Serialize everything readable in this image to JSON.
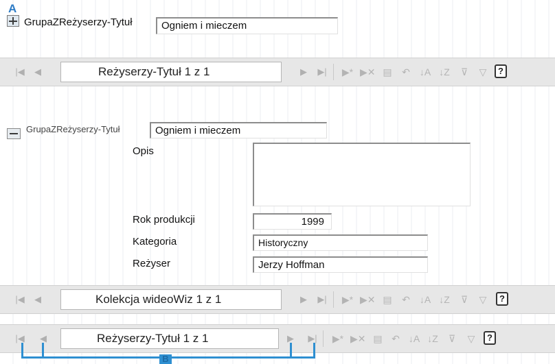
{
  "markers": {
    "a": "A",
    "b": "B"
  },
  "sectionA": {
    "group_label": "GrupaZReżyserzy-Tytuł",
    "title_value": "Ogniem i mieczem"
  },
  "nav1": {
    "record_text": "Reżyserzy-Tytuł 1 z 1",
    "help_label": "?"
  },
  "sectionB": {
    "group_label": "GrupaZReżyserzy-Tytuł",
    "title_value": "Ogniem i mieczem",
    "fields": [
      {
        "label": "Opis",
        "value": ""
      },
      {
        "label": "Rok produkcji",
        "value": "1999"
      },
      {
        "label": "Kategoria",
        "value": "Historyczny"
      },
      {
        "label": "Reżyser",
        "value": "Jerzy Hoffman"
      }
    ]
  },
  "nav2": {
    "record_text": "Kolekcja wideoWiz 1 z 1",
    "help_label": "?"
  },
  "nav3": {
    "record_text": "Reżyserzy-Tytuł 1 z 1",
    "help_label": "?"
  },
  "colors": {
    "accent": "#2e8fd1",
    "toolbar_bg": "#e7e7e7"
  }
}
